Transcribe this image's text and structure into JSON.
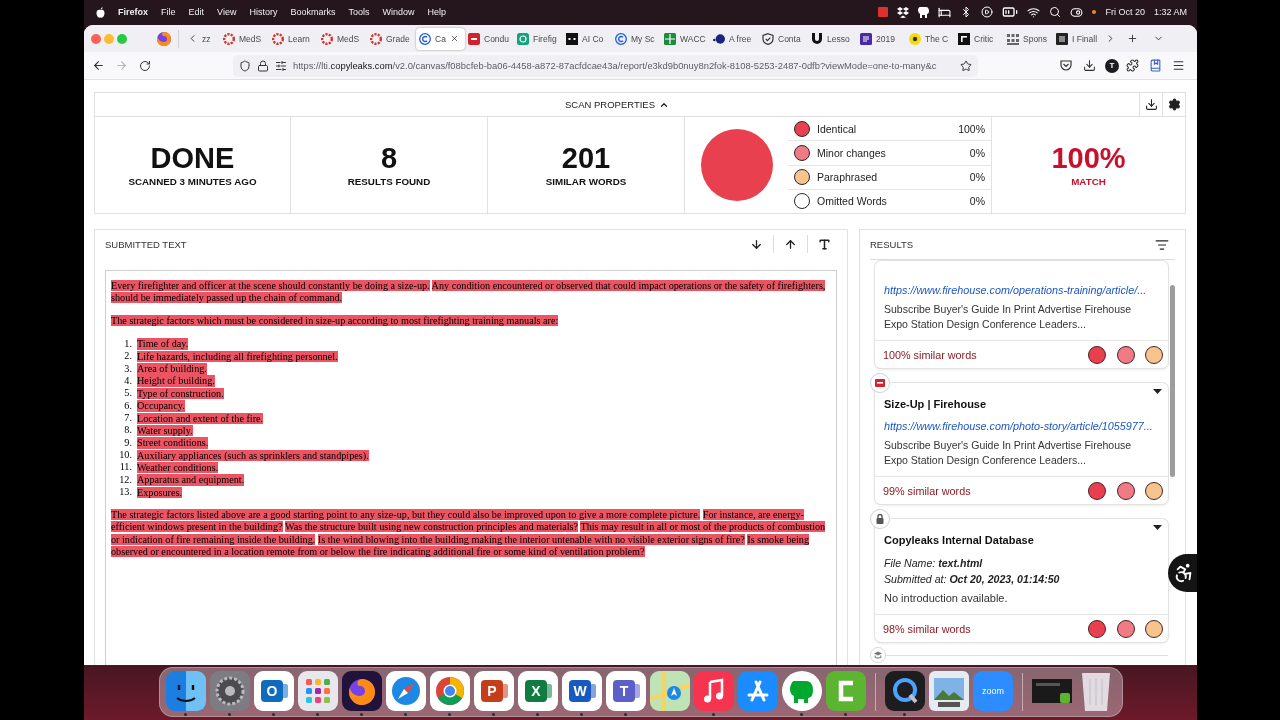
{
  "menubar": {
    "app": "Firefox",
    "menus": [
      "File",
      "Edit",
      "View",
      "History",
      "Bookmarks",
      "Tools",
      "Window",
      "Help"
    ],
    "date": "Fri Oct 20",
    "time": "1:32 AM"
  },
  "browser": {
    "tabs": [
      {
        "label": "zz",
        "kind": "none",
        "selected": false
      },
      {
        "label": "MedS",
        "kind": "ring",
        "selected": false
      },
      {
        "label": "Learn",
        "kind": "ring",
        "selected": false
      },
      {
        "label": "MedS",
        "kind": "ring",
        "selected": false
      },
      {
        "label": "Grade",
        "kind": "ring",
        "selected": false
      },
      {
        "label": "Ca",
        "kind": "c-mark",
        "selected": true
      },
      {
        "label": "Condu",
        "kind": "block",
        "selected": false
      },
      {
        "label": "Firefig",
        "kind": "knot",
        "selected": false
      },
      {
        "label": "AI Co",
        "kind": "dark-block",
        "selected": false
      },
      {
        "label": "My Sc",
        "kind": "c-mark",
        "selected": false
      },
      {
        "label": "WACC",
        "kind": "sheet",
        "selected": false
      },
      {
        "label": "A free",
        "kind": "dots",
        "selected": false
      },
      {
        "label": "Conta",
        "kind": "shield",
        "selected": false
      },
      {
        "label": "Lesso",
        "kind": "u-mark",
        "selected": false
      },
      {
        "label": "2019",
        "kind": "page",
        "selected": false
      },
      {
        "label": "The C",
        "kind": "disc",
        "selected": false
      },
      {
        "label": "Critic",
        "kind": "bar-block",
        "selected": false
      },
      {
        "label": "Spons",
        "kind": "grid",
        "selected": false
      },
      {
        "label": "I Finall",
        "kind": "frame",
        "selected": false
      }
    ],
    "back": {
      "disabled": false
    },
    "forward": {
      "disabled": true
    },
    "address": {
      "prefix": "https://lti.",
      "domain": "copyleaks.com",
      "path": "/v2.0/canvas/f08bcfeb-ba06-4458-a872-87acfdcae43a/report/e3kd9b0nuy8n2fok-8108-5253-2487-0dfb?viewMode=one-to-many&c"
    },
    "account_initial": "T"
  },
  "scan": {
    "title": "SCAN PROPERTIES",
    "expanded": true,
    "stats": [
      {
        "value": "DONE",
        "label": "SCANNED 3 MINUTES AGO"
      },
      {
        "value": "8",
        "label": "RESULTS FOUND"
      },
      {
        "value": "201",
        "label": "SIMILAR WORDS"
      }
    ],
    "chart_data": {
      "type": "pie",
      "values": [
        100,
        0,
        0,
        0
      ]
    },
    "legend": [
      {
        "label": "Identical",
        "value": "100%",
        "color": "#e8404f"
      },
      {
        "label": "Minor changes",
        "value": "0%",
        "color": "#f07b85"
      },
      {
        "label": "Paraphrased",
        "value": "0%",
        "color": "#f7c48e"
      },
      {
        "label": "Omitted Words",
        "value": "0%",
        "color": "#ffffff"
      }
    ],
    "match": {
      "value": "100%",
      "label": "MATCH"
    }
  },
  "submitted": {
    "title": "SUBMITTED TEXT",
    "blocks": [
      {
        "kind": "paragraph",
        "highlighted": true,
        "segments": [
          "Every firefighter and officer at the scene should constantly be doing a size-up.",
          "Any condition encountered or observed that could impact operations or the safety of firefighters, should be immediately passed up the chain of command."
        ]
      },
      {
        "kind": "paragraph",
        "highlighted": true,
        "segments": [
          "The strategic factors which must be considered in size-up according to most firefighting training manuals are:"
        ]
      },
      {
        "kind": "list",
        "items": [
          {
            "number": "1.",
            "text": "Time of day.",
            "highlighted": true
          },
          {
            "number": "2.",
            "text": "Life hazards, including all firefighting personnel.",
            "highlighted": true
          },
          {
            "number": "3.",
            "text": "Area of building.",
            "highlighted": true
          },
          {
            "number": "4.",
            "text": "Height of building.",
            "highlighted": true
          },
          {
            "number": "5.",
            "text": "Type of construction.",
            "highlighted": true
          },
          {
            "number": "6.",
            "text": "Occupancy.",
            "highlighted": true
          },
          {
            "number": "7.",
            "text": "Location and extent of the fire.",
            "highlighted": true
          },
          {
            "number": "8.",
            "text": "Water supply.",
            "highlighted": true
          },
          {
            "number": "9.",
            "text": "Street conditions.",
            "highlighted": true
          },
          {
            "number": "10.",
            "text": "Auxiliary appliances (such as sprinklers and standpipes).",
            "highlighted": true
          },
          {
            "number": "11.",
            "text": "Weather conditions.",
            "highlighted": true
          },
          {
            "number": "12.",
            "text": "Apparatus and equipment.",
            "highlighted": true
          },
          {
            "number": "13.",
            "text": "Exposures.",
            "highlighted": true
          }
        ]
      },
      {
        "kind": "paragraph",
        "highlighted": true,
        "segments": [
          "The strategic factors listed above are a good starting point to any size-up, but they could also be improved upon to give a more complete picture.",
          "For instance, are energy-efficient windows present in the building?",
          "Was the structure built using new construction principles and materials?",
          "This may result in all or most of the products of combustion or indication of fire remaining inside the building.",
          "Is the wind blowing into the building making the interior untenable with no visible exterior signs of fire?",
          "Is smoke being observed or encountered in a location remote from or below the fire indicating additional fire or some kind of ventilation problem?"
        ]
      }
    ]
  },
  "results": {
    "title": "RESULTS",
    "cards": [
      {
        "url": "https://www.firehouse.com/operations-training/article/...",
        "snippet": "Subscribe Buyer's Guide In Print Advertise Firehouse Expo Station Design Conference Leaders...",
        "similarity": "100% similar words"
      },
      {
        "kind": "web",
        "title": "Size-Up | Firehouse",
        "url": "https://www.firehouse.com/photo-story/article/1055977...",
        "snippet": "Subscribe Buyer's Guide In Print Advertise Firehouse Expo Station Design Conference Leaders...",
        "similarity": "99% similar words"
      },
      {
        "kind": "lock",
        "title": "Copyleaks Internal Database",
        "details": [
          "File Name: **text.html**",
          "Submitted at: **Oct 20, 2023, 01:14:50**"
        ],
        "snippet": "No introduction available.",
        "similarity": "98% similar words"
      },
      {
        "kind": "stack"
      }
    ]
  },
  "dock": {
    "apps": [
      {
        "kind": "face",
        "running": true
      },
      {
        "kind": "gear",
        "running": true
      },
      {
        "kind": "mail-tile",
        "text": "O",
        "running": true
      },
      {
        "kind": "grid",
        "running": true
      },
      {
        "kind": "fox",
        "running": true
      },
      {
        "kind": "compass",
        "running": true
      },
      {
        "kind": "ring",
        "running": true
      },
      {
        "kind": "slide-tile",
        "text": "P",
        "running": true
      },
      {
        "kind": "sheet-tile",
        "text": "X",
        "running": true
      },
      {
        "kind": "doc-tile",
        "text": "W",
        "running": true
      },
      {
        "kind": "team-tile",
        "text": "T",
        "running": true
      },
      {
        "kind": "map",
        "running": false
      },
      {
        "kind": "note",
        "running": true
      },
      {
        "kind": "store",
        "running": false
      },
      {
        "kind": "elephant",
        "running": true
      },
      {
        "kind": "bracket",
        "running": true
      },
      {
        "kind": "separator"
      },
      {
        "kind": "lens",
        "running": true
      },
      {
        "kind": "photo",
        "running": false
      },
      {
        "kind": "text",
        "text": "zoom",
        "running": false
      },
      {
        "kind": "separator"
      },
      {
        "kind": "thumb",
        "running": false
      },
      {
        "kind": "bin",
        "running": false
      }
    ]
  }
}
